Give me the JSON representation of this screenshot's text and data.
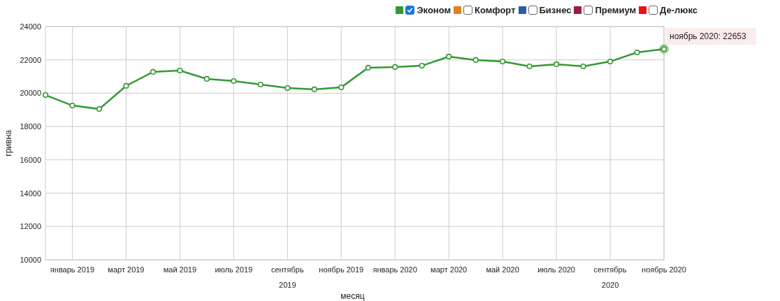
{
  "legend": {
    "series_checked": true,
    "items": [
      {
        "label": "Комфорт",
        "color": "#e67e22",
        "checked": false
      },
      {
        "label": "Бизнес",
        "color": "#2a5ca8",
        "checked": false
      },
      {
        "label": "Премиум",
        "color": "#9b1b4a",
        "checked": false
      },
      {
        "label": "Де-люкс",
        "color": "#ee1111",
        "checked": false
      }
    ]
  },
  "chart_data": {
    "type": "line",
    "xlabel": "месяц",
    "ylabel": "гривна",
    "grid": true,
    "categories": [
      null,
      "январь 2019",
      null,
      "март 2019",
      null,
      "май 2019",
      null,
      "июль 2019",
      null,
      "сентябрь 2019",
      null,
      "ноябрь 2019",
      null,
      "январь 2020",
      null,
      "март 2020",
      null,
      "май 2020",
      null,
      "июль 2020",
      null,
      "сентябрь 2020",
      null,
      "ноябрь 2020"
    ],
    "series": [
      {
        "name": "Эконом",
        "color": "#339933",
        "marker": "circle",
        "values": [
          19890,
          19260,
          19050,
          20440,
          21280,
          21360,
          20860,
          20730,
          20520,
          20310,
          20230,
          20350,
          21530,
          21570,
          21650,
          22200,
          21990,
          21900,
          21610,
          21740,
          21610,
          21900,
          22450,
          22653
        ]
      }
    ],
    "ylim": [
      10000,
      24000
    ],
    "yticks": [
      10000,
      12000,
      14000,
      16000,
      18000,
      20000,
      22000,
      24000
    ],
    "annotations": [
      "ноябрь 2020: 22653"
    ]
  }
}
